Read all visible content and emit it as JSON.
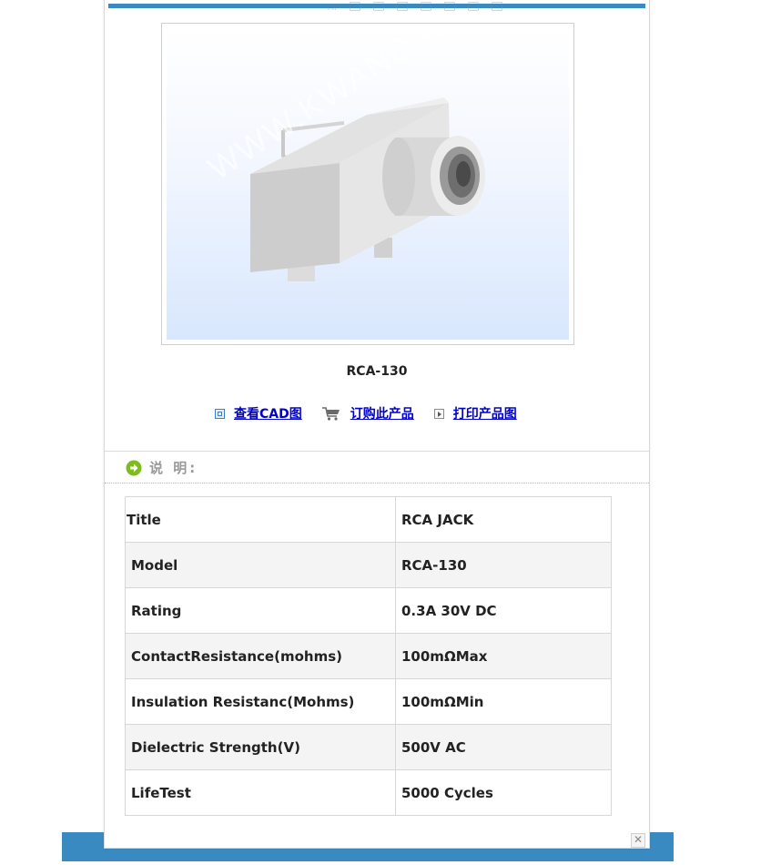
{
  "top_bar": {
    "ghost_text": "AI"
  },
  "product": {
    "watermark": "WWW.KWANDA.NET",
    "model": "RCA-130"
  },
  "actions": [
    {
      "label": "查看CAD图",
      "icon": "cad-view-icon"
    },
    {
      "label": "订购此产品",
      "icon": "shopping-cart-icon"
    },
    {
      "label": "打印产品图",
      "icon": "print-play-icon"
    }
  ],
  "section": {
    "title": "说 明:"
  },
  "specs": [
    {
      "label": "Title",
      "value": "RCA JACK"
    },
    {
      "label": "Model",
      "value": "RCA-130"
    },
    {
      "label": "Rating",
      "value": "0.3A 30V DC"
    },
    {
      "label": "ContactResistance(mohms)",
      "value": "100mΩMax"
    },
    {
      "label": "Insulation Resistanc(Mohms)",
      "value": "100mΩMin"
    },
    {
      "label": "Dielectric Strength(V)",
      "value": "500V AC"
    },
    {
      "label": "LifeTest",
      "value": "5000 Cycles"
    }
  ],
  "close": {
    "symbol": "✕"
  },
  "colors": {
    "accent_blue": "#3a8ac2",
    "link": "#0000cc",
    "section_icon": "#7dbb1f"
  }
}
